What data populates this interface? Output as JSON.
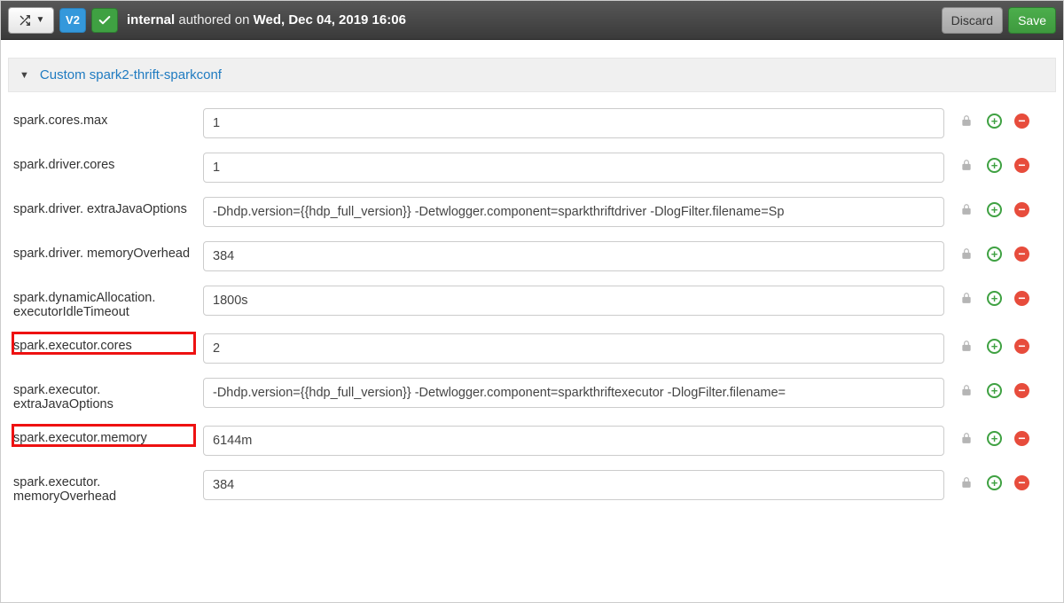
{
  "topbar": {
    "version_badge": "V2",
    "author_prefix": "internal",
    "authored_text": " authored on ",
    "authored_date": "Wed, Dec 04, 2019 16:06",
    "discard_label": "Discard",
    "save_label": "Save"
  },
  "section": {
    "title": "Custom spark2-thrift-sparkconf"
  },
  "rows": [
    {
      "label": "spark.cores.max",
      "value": "1",
      "highlight": false
    },
    {
      "label": "spark.driver.cores",
      "value": "1",
      "highlight": false
    },
    {
      "label": "spark.driver. extraJavaOptions",
      "value": "-Dhdp.version={{hdp_full_version}} -Detwlogger.component=sparkthriftdriver -DlogFilter.filename=Sp",
      "highlight": false
    },
    {
      "label": "spark.driver. memoryOverhead",
      "value": "384",
      "highlight": false
    },
    {
      "label": "spark.dynamicAllocation. executorIdleTimeout",
      "value": "1800s",
      "highlight": false
    },
    {
      "label": "spark.executor.cores",
      "value": "2",
      "highlight": true
    },
    {
      "label": "spark.executor. extraJavaOptions",
      "value": "-Dhdp.version={{hdp_full_version}} -Detwlogger.component=sparkthriftexecutor -DlogFilter.filename=",
      "highlight": false
    },
    {
      "label": "spark.executor.memory",
      "value": "6144m",
      "highlight": true
    },
    {
      "label": "spark.executor. memoryOverhead",
      "value": "384",
      "highlight": false
    }
  ]
}
